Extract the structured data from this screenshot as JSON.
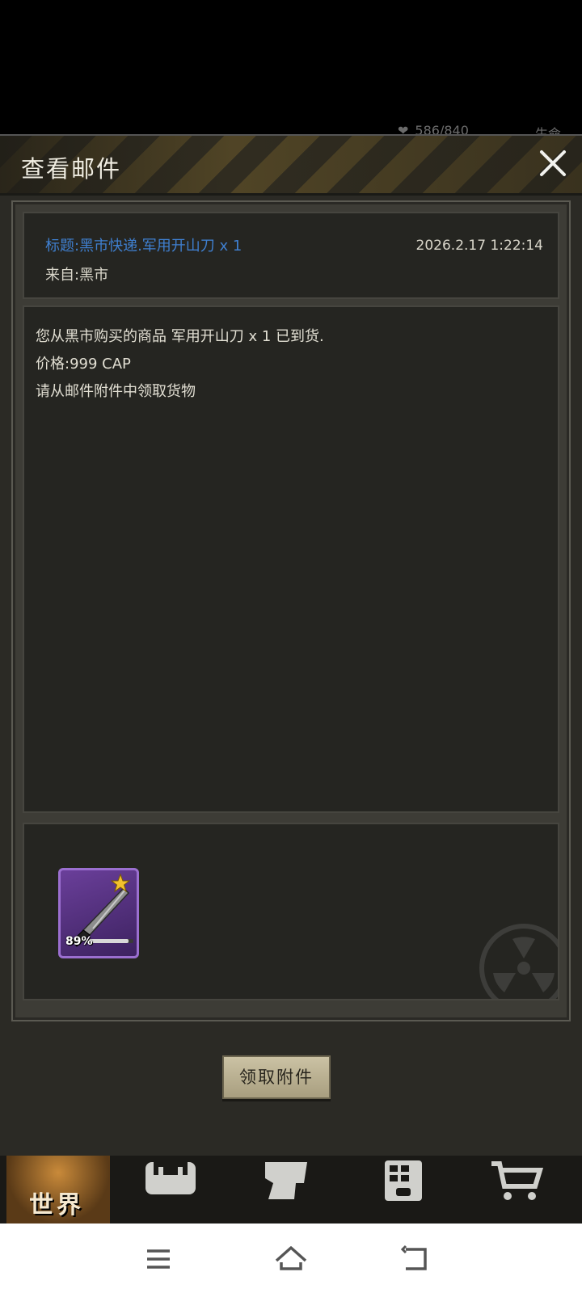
{
  "status": {
    "hp_text": "586/840",
    "life_label": "生命"
  },
  "dialog": {
    "title": "查看邮件",
    "close_icon": "close-icon"
  },
  "mail": {
    "subject": "标题:黑市快递.军用开山刀 x 1",
    "from": "来自:黑市",
    "time": "2026.2.17 1:22:14",
    "body_lines": [
      "您从黑市购买的商品 军用开山刀 x 1 已到货.",
      "价格:999 CAP",
      "请从邮件附件中领取货物"
    ]
  },
  "attachment": {
    "item_icon": "machete-icon",
    "durability_text": "89%",
    "durability_value": 0.89,
    "star_icon": "star-icon"
  },
  "claim_button_label": "领取附件",
  "game_nav": {
    "world_label": "世界",
    "icons": [
      "backpack-icon",
      "character-head-icon",
      "building-icon",
      "shopping-cart-icon"
    ]
  },
  "system_nav": [
    "menu-icon",
    "home-icon",
    "back-icon"
  ],
  "colors": {
    "subject_blue": "#3f7fcf",
    "item_purple": "#6a3f9a",
    "panel_bg": "#252521"
  }
}
